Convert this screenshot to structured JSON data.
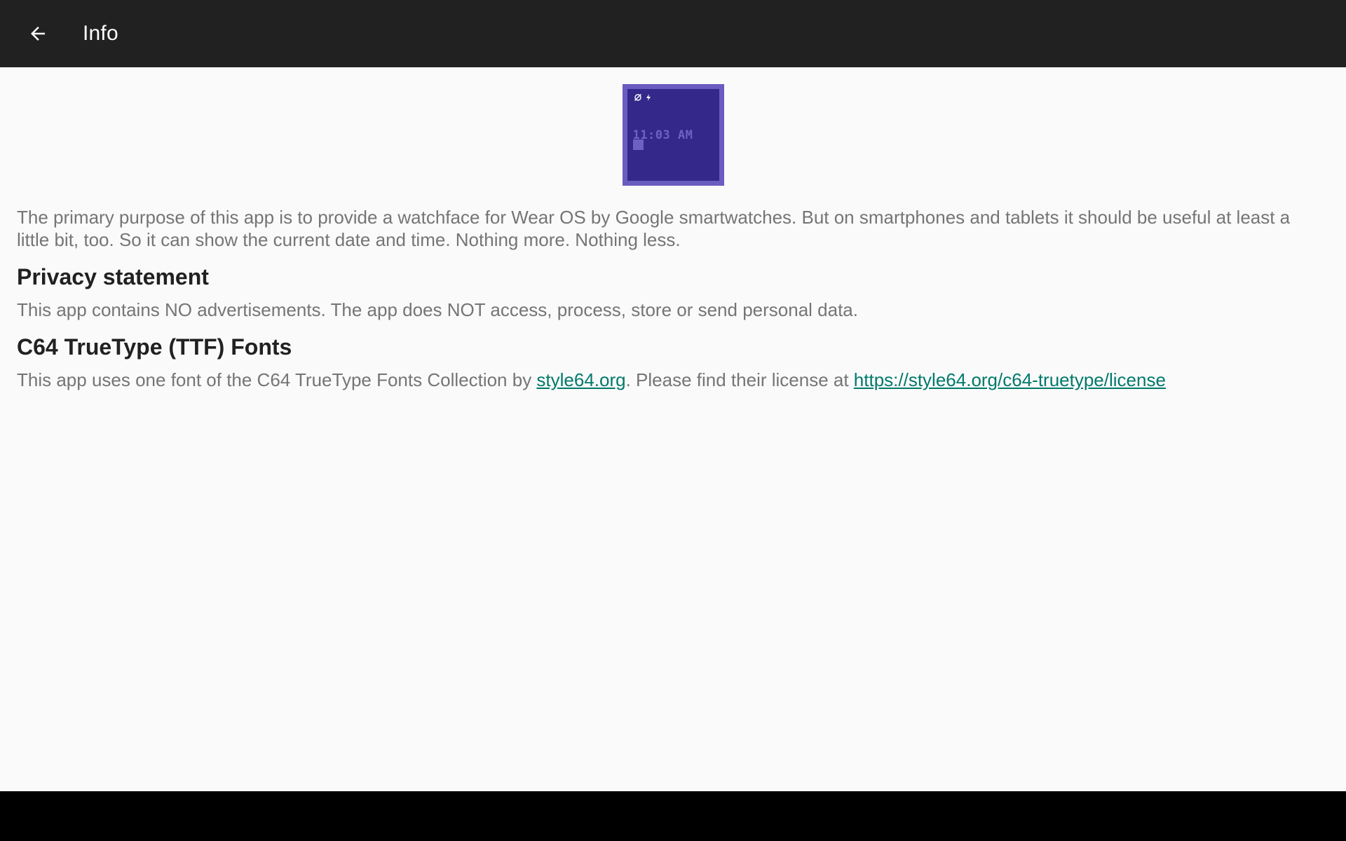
{
  "app_bar": {
    "title": "Info",
    "back_icon": "arrow-back-icon",
    "background": "#212121"
  },
  "watch_preview": {
    "time": "11:03 AM",
    "status_icons": [
      "ambient-mode-icon",
      "charging-icon"
    ],
    "frame_color": "#6a5cc0",
    "screen_color": "#34298a",
    "text_color": "#6e61c4"
  },
  "description": "The primary purpose of this app is to provide a watchface for Wear OS by Google smartwatches. But on smartphones and tablets it should be useful at least a little bit, too. So it can show the current date and time. Nothing more. Nothing less.",
  "privacy": {
    "heading": "Privacy statement",
    "text": "This app contains NO advertisements. The app does NOT access, process, store or send personal data."
  },
  "fonts": {
    "heading": "C64 TrueType (TTF) Fonts",
    "text_before": "This app uses one font of the C64 TrueType Fonts Collection by ",
    "link1": "style64.org",
    "text_middle": ". Please find their license at ",
    "link2": "https://style64.org/c64-truetype/license"
  },
  "colors": {
    "link": "#00796b",
    "body_text": "#757575",
    "heading_text": "#212121",
    "background": "#fafafa"
  }
}
